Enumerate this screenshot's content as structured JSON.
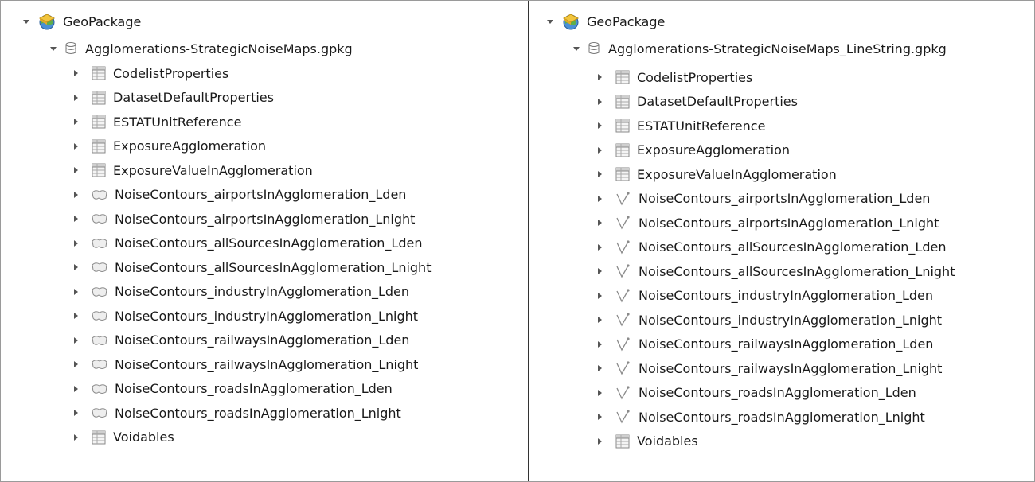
{
  "panes": [
    {
      "root_label": "GeoPackage",
      "gpkg_label": "Agglomerations-StrategicNoiseMaps.gpkg",
      "layer_icon": "polygon-layer-icon",
      "items": [
        {
          "label": "CodelistProperties",
          "kind": "table"
        },
        {
          "label": "DatasetDefaultProperties",
          "kind": "table"
        },
        {
          "label": "ESTATUnitReference",
          "kind": "table"
        },
        {
          "label": "ExposureAgglomeration",
          "kind": "table"
        },
        {
          "label": "ExposureValueInAgglomeration",
          "kind": "table"
        },
        {
          "label": "NoiseContours_airportsInAgglomeration_Lden",
          "kind": "layer"
        },
        {
          "label": "NoiseContours_airportsInAgglomeration_Lnight",
          "kind": "layer"
        },
        {
          "label": "NoiseContours_allSourcesInAgglomeration_Lden",
          "kind": "layer"
        },
        {
          "label": "NoiseContours_allSourcesInAgglomeration_Lnight",
          "kind": "layer"
        },
        {
          "label": "NoiseContours_industryInAgglomeration_Lden",
          "kind": "layer"
        },
        {
          "label": "NoiseContours_industryInAgglomeration_Lnight",
          "kind": "layer"
        },
        {
          "label": "NoiseContours_railwaysInAgglomeration_Lden",
          "kind": "layer"
        },
        {
          "label": "NoiseContours_railwaysInAgglomeration_Lnight",
          "kind": "layer"
        },
        {
          "label": "NoiseContours_roadsInAgglomeration_Lden",
          "kind": "layer"
        },
        {
          "label": "NoiseContours_roadsInAgglomeration_Lnight",
          "kind": "layer"
        },
        {
          "label": "Voidables",
          "kind": "table"
        }
      ]
    },
    {
      "root_label": "GeoPackage",
      "gpkg_label": "Agglomerations-StrategicNoiseMaps_LineString.gpkg",
      "layer_icon": "linestring-layer-icon",
      "items": [
        {
          "label": "CodelistProperties",
          "kind": "table"
        },
        {
          "label": "DatasetDefaultProperties",
          "kind": "table"
        },
        {
          "label": "ESTATUnitReference",
          "kind": "table"
        },
        {
          "label": "ExposureAgglomeration",
          "kind": "table"
        },
        {
          "label": "ExposureValueInAgglomeration",
          "kind": "table"
        },
        {
          "label": "NoiseContours_airportsInAgglomeration_Lden",
          "kind": "layer"
        },
        {
          "label": "NoiseContours_airportsInAgglomeration_Lnight",
          "kind": "layer"
        },
        {
          "label": "NoiseContours_allSourcesInAgglomeration_Lden",
          "kind": "layer"
        },
        {
          "label": "NoiseContours_allSourcesInAgglomeration_Lnight",
          "kind": "layer"
        },
        {
          "label": "NoiseContours_industryInAgglomeration_Lden",
          "kind": "layer"
        },
        {
          "label": "NoiseContours_industryInAgglomeration_Lnight",
          "kind": "layer"
        },
        {
          "label": "NoiseContours_railwaysInAgglomeration_Lden",
          "kind": "layer"
        },
        {
          "label": "NoiseContours_railwaysInAgglomeration_Lnight",
          "kind": "layer"
        },
        {
          "label": "NoiseContours_roadsInAgglomeration_Lden",
          "kind": "layer"
        },
        {
          "label": "NoiseContours_roadsInAgglomeration_Lnight",
          "kind": "layer"
        },
        {
          "label": "Voidables",
          "kind": "table"
        }
      ]
    }
  ]
}
